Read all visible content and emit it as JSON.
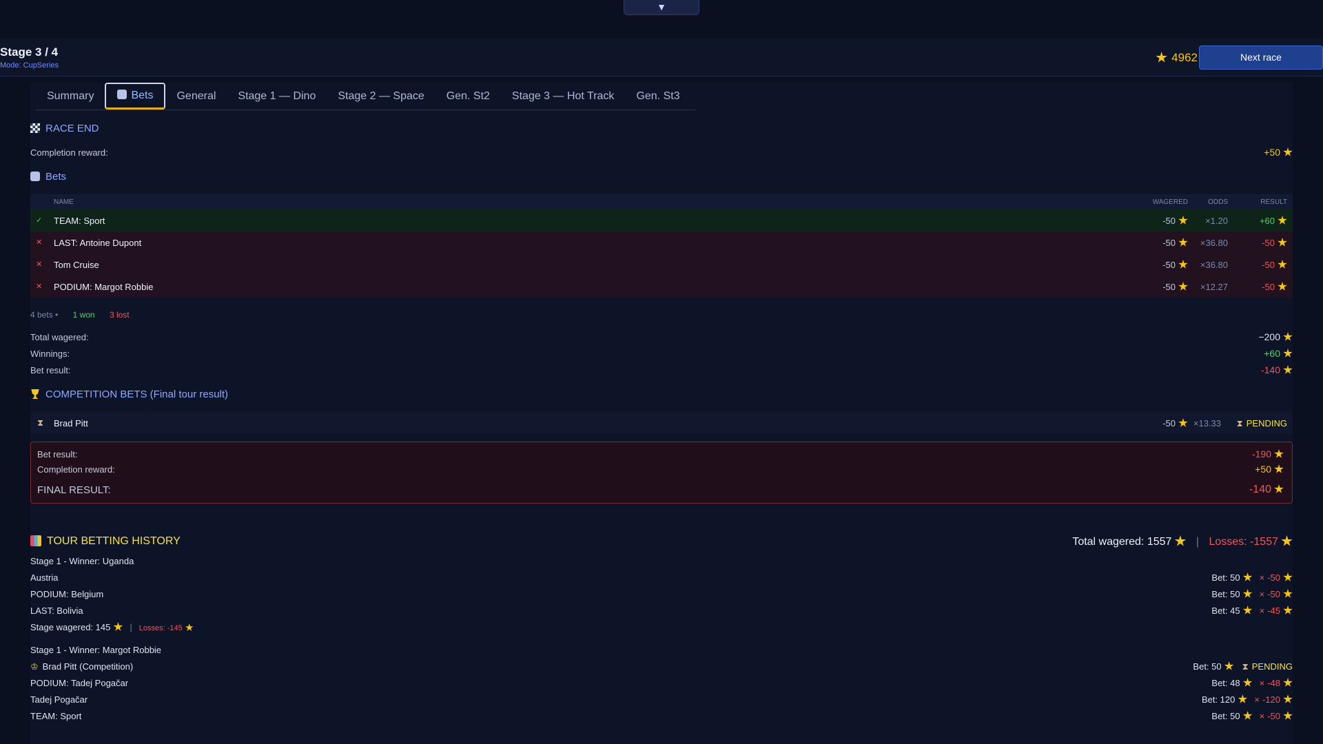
{
  "pull_tab": "▼",
  "header": {
    "stage": "Stage 3 / 4",
    "mode": "Mode: CupSeries",
    "balance": "4962",
    "next_race": "Next race"
  },
  "tabs": [
    {
      "label": "Summary"
    },
    {
      "label": "Bets"
    },
    {
      "label": "General"
    },
    {
      "label": "Stage 1 — Dino"
    },
    {
      "label": "Stage 2 — Space"
    },
    {
      "label": "Gen. St2"
    },
    {
      "label": "Stage 3 — Hot Track"
    },
    {
      "label": "Gen. St3"
    }
  ],
  "race_end": {
    "title": "RACE END",
    "completion_label": "Completion reward:",
    "completion_value": "+50"
  },
  "bets": {
    "title": "Bets",
    "columns": {
      "name": "NAME",
      "wagered": "WAGERED",
      "odds": "ODDS",
      "result": "RESULT"
    },
    "rows": [
      {
        "mark": "✓",
        "name": "TEAM: Sport",
        "wagered": "-50",
        "odds": "×1.20",
        "result": "+60"
      },
      {
        "mark": "✕",
        "name": "LAST: Antoine Dupont",
        "wagered": "-50",
        "odds": "×36.80",
        "result": "-50"
      },
      {
        "mark": "✕",
        "name": "Tom Cruise",
        "wagered": "-50",
        "odds": "×36.80",
        "result": "-50"
      },
      {
        "mark": "✕",
        "name": "PODIUM: Margot Robbie",
        "wagered": "-50",
        "odds": "×12.27",
        "result": "-50"
      }
    ],
    "summary": {
      "count": "4 bets •",
      "won": "1 won",
      "lost": "3 lost"
    },
    "totals": {
      "wagered_label": "Total wagered:",
      "wagered_value": "−200",
      "winnings_label": "Winnings:",
      "winnings_value": "+60",
      "result_label": "Bet result:",
      "result_value": "-140"
    }
  },
  "competition": {
    "title": "COMPETITION BETS (Final tour result)",
    "row": {
      "name": "Brad Pitt",
      "wagered": "-50",
      "odds": "×13.33",
      "status": "PENDING"
    }
  },
  "final": {
    "bet_result_label": "Bet result:",
    "bet_result_value": "-190",
    "completion_label": "Completion reward:",
    "completion_value": "+50",
    "final_label": "FINAL RESULT:",
    "final_value": "-140"
  },
  "history": {
    "title": "TOUR BETTING HISTORY",
    "total_wagered": "Total wagered: 1557",
    "losses": "Losses: -1557",
    "group1": {
      "header": "Stage 1 - Winner: Uganda",
      "rows": [
        {
          "label": "Austria",
          "bet": "Bet: 50",
          "result": "-50"
        },
        {
          "label": "PODIUM: Belgium",
          "bet": "Bet: 50",
          "result": "-50"
        },
        {
          "label": "LAST: Bolivia",
          "bet": "Bet: 45",
          "result": "-45"
        }
      ],
      "stage_wagered": "Stage wagered: 145",
      "stage_losses": "Losses: -145"
    },
    "group2": {
      "header": "Stage 1 - Winner: Margot Robbie",
      "rows": [
        {
          "label": "Brad Pitt (Competition)",
          "bet": "Bet: 50",
          "status": "PENDING"
        },
        {
          "label": "PODIUM: Tadej Pogačar",
          "bet": "Bet: 48",
          "result": "-48"
        },
        {
          "label": "Tadej Pogačar",
          "bet": "Bet: 120",
          "result": "-120"
        },
        {
          "label": "TEAM: Sport",
          "bet": "Bet: 50",
          "result": "-50"
        }
      ]
    }
  }
}
